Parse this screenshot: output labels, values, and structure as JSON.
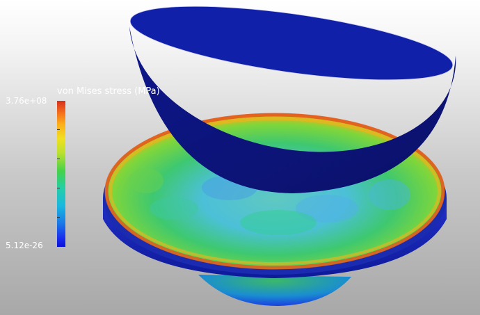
{
  "colorbar": {
    "title": "von Mises stress (MPa)",
    "max_label": "3.76e+08",
    "min_label": "5.12e-26"
  },
  "colors": {
    "background_top": "#ffffff",
    "background_bottom": "#a8a8a8",
    "indenter": "#141a8a",
    "plate_rim": "#1a2bb0",
    "high_stress": "#d7301f",
    "mid_stress": "#34c85a",
    "low_stress": "#1a40e0"
  }
}
